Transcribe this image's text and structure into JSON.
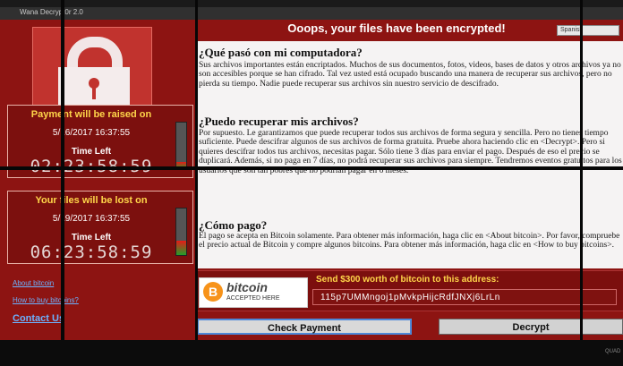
{
  "window": {
    "title": "Wana Decrypt0r 2.0"
  },
  "heading": "Ooops, your files have been encrypted!",
  "language": "Spanish",
  "timers": [
    {
      "header": "Payment will be raised on",
      "date": "5/16/2017 16:37:55",
      "label": "Time Left",
      "countdown": "02:23:58:59",
      "level": 0.15
    },
    {
      "header": "Your files will be lost on",
      "date": "5/19/2017 16:37:55",
      "label": "Time Left",
      "countdown": "06:23:58:59",
      "level": 0.3
    }
  ],
  "links": {
    "about": "About bitcoin",
    "how_to_buy": "How to buy bitcoins?",
    "contact": "Contact Us"
  },
  "text": {
    "h1": "¿Qué pasó con mi computadora?",
    "p1": "Sus archivos importantes están encriptados. Muchos de sus documentos, fotos, videos, bases de datos y otros archivos ya no son accesibles porque se han cifrado. Tal vez usted está ocupado buscando una manera de recuperar sus archivos, pero no pierda su tiempo. Nadie puede recuperar sus archivos sin nuestro servicio de descifrado.",
    "h2": "¿Puedo recuperar mis archivos?",
    "p2": "Por supuesto. Le garantizamos que puede recuperar todos sus archivos de forma segura y sencilla. Pero no tienes tiempo suficiente. Puede descifrar algunos de sus archivos de forma gratuita. Pruebe ahora haciendo clic en <Decrypt>. Pero si quieres descifrar todos tus archivos, necesitas pagar. Sólo tiene 3 días para enviar el pago. Después de eso el precio se duplicará. Además, si no paga en 7 días, no podrá recuperar sus archivos para siempre. Tendremos eventos gratuitos para los usuarios que son tan pobres que no podrían pagar en 6 meses.",
    "h3": "¿Cómo pago?",
    "p3": "El pago se acepta en Bitcoin solamente. Para obtener más información, haga clic en <About bitcoin>. Por favor, compruebe el precio actual de Bitcoin y compre algunos bitcoins. Para obtener más información, haga clic en <How to buy bitcoins>."
  },
  "payment": {
    "badge_word": "bitcoin",
    "badge_sub": "ACCEPTED HERE",
    "coin_glyph": "B",
    "send_text": "Send $300 worth of bitcoin to this address:",
    "address": "115p7UMMngoj1pMvkpHijcRdfJNXj6LrLn"
  },
  "buttons": {
    "check": "Check Payment",
    "decrypt": "Decrypt"
  },
  "display_brand": "QUAD",
  "colors": {
    "background": "#8d1412",
    "accent_yellow": "#ffd64a",
    "link_blue": "#6cb2ff",
    "bitcoin_orange": "#f7931a"
  }
}
